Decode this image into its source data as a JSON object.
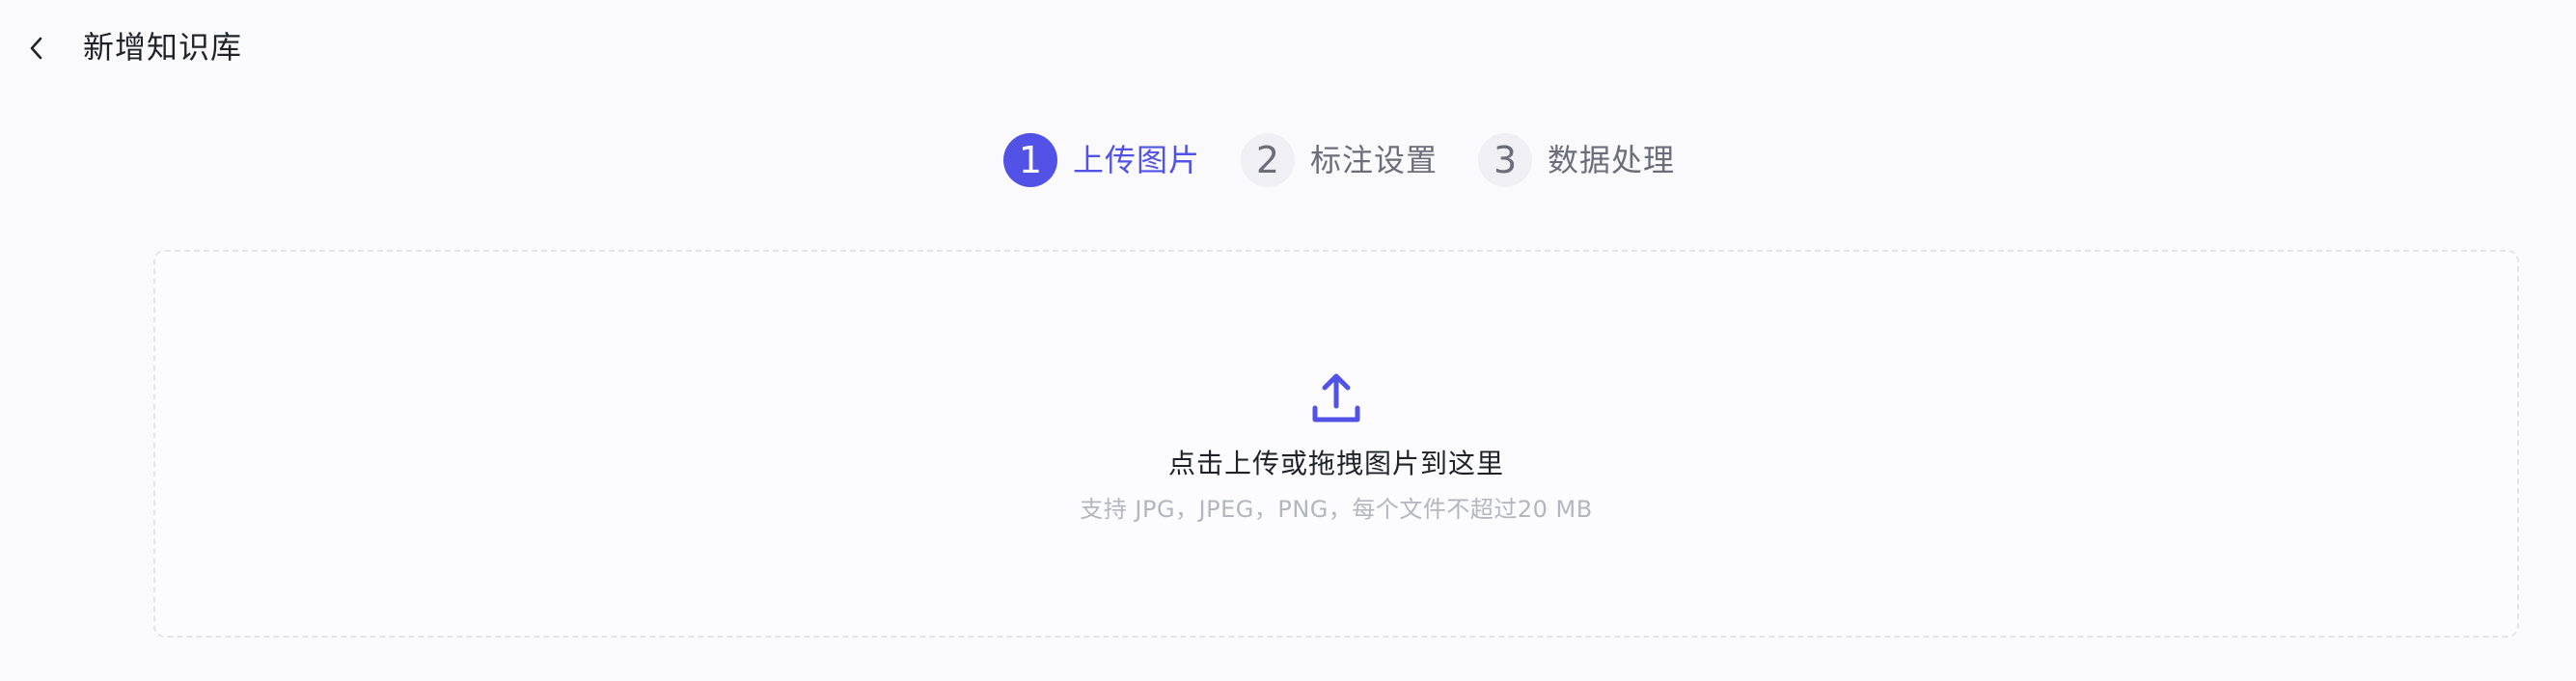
{
  "header": {
    "back_icon": "chevron-left-icon",
    "title": "新增知识库"
  },
  "steps": [
    {
      "number": "1",
      "label": "上传图片",
      "state": "active"
    },
    {
      "number": "2",
      "label": "标注设置",
      "state": "inactive"
    },
    {
      "number": "3",
      "label": "数据处理",
      "state": "inactive"
    }
  ],
  "upload": {
    "icon": "upload-icon",
    "main_text": "点击上传或拖拽图片到这里",
    "hint_text": "支持 JPG，JPEG，PNG，每个文件不超过20 MB"
  },
  "colors": {
    "accent": "#5252e6",
    "background": "#fafafc",
    "inactive_text": "#6b6e7a",
    "hint_text": "#b4b6bf",
    "border": "#e4e5ea"
  }
}
